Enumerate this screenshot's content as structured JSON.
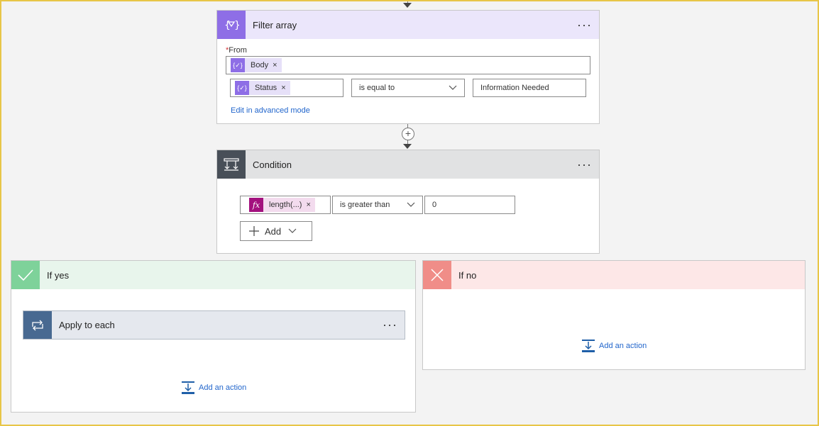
{
  "filter_array": {
    "title": "Filter array",
    "menu": "···",
    "from_required": "*",
    "from_label": "From",
    "from_token": "Body",
    "left_token": "Status",
    "operator": "is equal to",
    "value": "Information Needed",
    "advanced_link": "Edit in advanced mode",
    "header_color": "#ebe6fb",
    "icon_color": "#8e6ee6"
  },
  "insert_step": "+",
  "condition": {
    "title": "Condition",
    "menu": "···",
    "token": "length(...)",
    "operator": "is greater than",
    "value": "0",
    "add_label": "Add",
    "header_color": "#e1e2e3",
    "icon_color": "#484f58"
  },
  "if_yes": {
    "title": "If yes",
    "apply_to_each": "Apply to each",
    "menu": "···",
    "add_action": "Add an action",
    "header_color": "#e8f5ec",
    "icon_color": "#7ed29a"
  },
  "if_no": {
    "title": "If no",
    "add_action": "Add an action",
    "header_color": "#fde7e7",
    "icon_color": "#f08d88"
  },
  "token_remove": "×",
  "icons": {
    "filter": "filter-array-icon",
    "condition": "condition-icon",
    "check": "check-icon",
    "close": "close-icon",
    "loop": "loop-icon",
    "add_action": "add-action-icon",
    "fx": "fx-icon",
    "variable": "dynamic-content-icon"
  }
}
